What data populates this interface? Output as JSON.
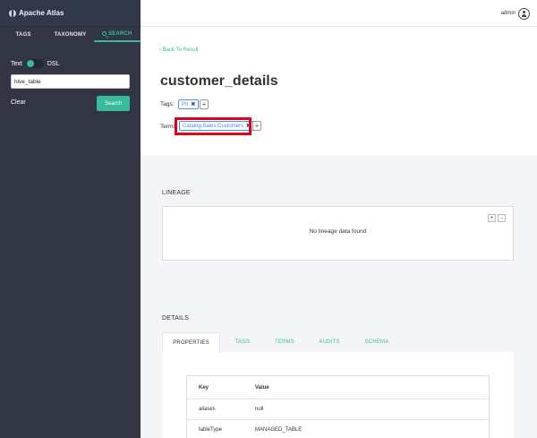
{
  "app": {
    "title": "Apache Atlas"
  },
  "sidebar": {
    "tabs": [
      {
        "label": "TAGS"
      },
      {
        "label": "TAXONOMY"
      },
      {
        "label": "SEARCH"
      }
    ],
    "toggle": {
      "left_label": "Text",
      "right_label": "DSL"
    },
    "search_value": "hive_table",
    "clear_label": "Clear",
    "search_button": "Search"
  },
  "header": {
    "user": "admin"
  },
  "entity": {
    "back_label": "Back To Result",
    "title": "customer_details",
    "tags_label": "Tags:",
    "tags": [
      "PII"
    ],
    "terms_label": "Terms:",
    "terms": [
      "Catalog.Sales.Customers"
    ]
  },
  "lineage": {
    "title": "LINEAGE",
    "empty_message": "No lineage data found",
    "zoom_in": "+",
    "zoom_out": "-"
  },
  "details": {
    "title": "DETAILS",
    "tabs": [
      "PROPERTIES",
      "TAGS",
      "TERMS",
      "AUDITS",
      "SCHEMA"
    ],
    "active_tab": "PROPERTIES",
    "columns": [
      "Key",
      "Value"
    ],
    "rows": [
      {
        "key": "aliases",
        "value": "null"
      },
      {
        "key": "tableType",
        "value": "MANAGED_TABLE"
      }
    ]
  },
  "colors": {
    "accent": "#38bb9b",
    "sidebar": "#323544",
    "highlight": "#e0001a",
    "tag": "#4a90e2"
  }
}
